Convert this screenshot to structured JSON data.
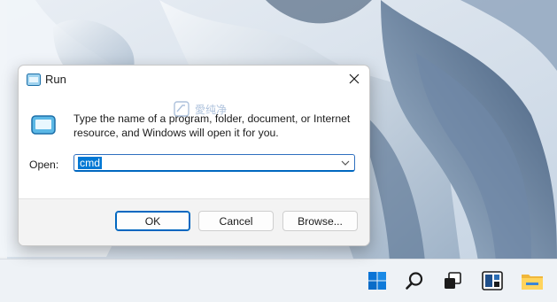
{
  "dialog": {
    "title": "Run",
    "description": "Type the name of a program, folder, document, or Internet resource, and Windows will open it for you.",
    "open_label": "Open:",
    "open_value": "cmd",
    "buttons": {
      "ok": "OK",
      "cancel": "Cancel",
      "browse": "Browse..."
    }
  },
  "watermark": {
    "text": "愛纯净"
  },
  "icons": {
    "title": "run-icon",
    "close": "close-icon",
    "dropdown": "chevron-down-icon",
    "taskbar": [
      "start-icon",
      "search-icon",
      "task-view-icon",
      "widgets-icon",
      "file-explorer-icon"
    ]
  },
  "colors": {
    "accent": "#0067c0",
    "selection": "#0078d4",
    "footer": "#f3f3f3",
    "taskbar": "#eef2f6"
  }
}
